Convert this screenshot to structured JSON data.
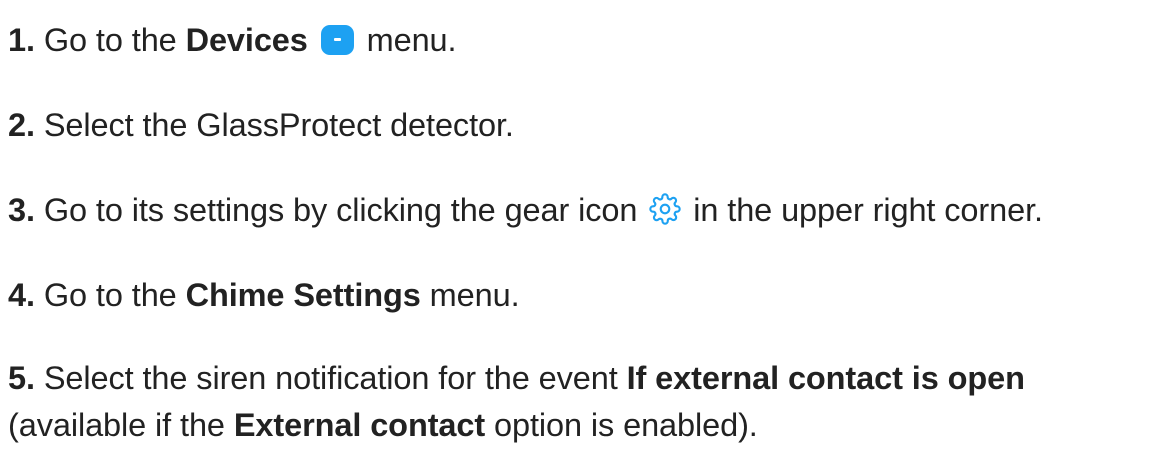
{
  "steps": [
    {
      "num": "1.",
      "t1": "Go to the ",
      "b1": "Devices",
      "icon": "devices-icon",
      "t2": " menu."
    },
    {
      "num": "2.",
      "t1": "Select the GlassProtect detector."
    },
    {
      "num": "3.",
      "t1": "Go to its settings by clicking the gear icon ",
      "icon": "gear-icon",
      "t2": " in the upper right corner."
    },
    {
      "num": "4.",
      "t1": "Go to the ",
      "b1": "Chime Settings",
      "t2": " menu."
    },
    {
      "num": "5.",
      "t1": "Select the siren notification for the event ",
      "b1": "If external contact is open",
      "t2": " (available if the ",
      "b2": "External contact",
      "t3": " option is enabled)."
    }
  ],
  "colors": {
    "text": "#222222",
    "accent": "#1da1f2"
  }
}
